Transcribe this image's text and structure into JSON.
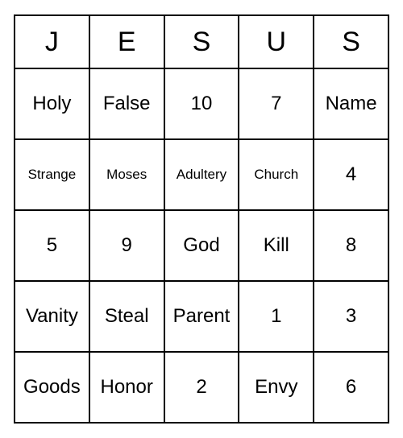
{
  "headers": [
    "J",
    "E",
    "S",
    "U",
    "S"
  ],
  "rows": [
    [
      {
        "text": "Holy",
        "small": false
      },
      {
        "text": "False",
        "small": false
      },
      {
        "text": "10",
        "small": false
      },
      {
        "text": "7",
        "small": false
      },
      {
        "text": "Name",
        "small": false
      }
    ],
    [
      {
        "text": "Strange",
        "small": true
      },
      {
        "text": "Moses",
        "small": true
      },
      {
        "text": "Adultery",
        "small": true
      },
      {
        "text": "Church",
        "small": true
      },
      {
        "text": "4",
        "small": false
      }
    ],
    [
      {
        "text": "5",
        "small": false
      },
      {
        "text": "9",
        "small": false
      },
      {
        "text": "God",
        "small": false
      },
      {
        "text": "Kill",
        "small": false
      },
      {
        "text": "8",
        "small": false
      }
    ],
    [
      {
        "text": "Vanity",
        "small": false
      },
      {
        "text": "Steal",
        "small": false
      },
      {
        "text": "Parent",
        "small": false
      },
      {
        "text": "1",
        "small": false
      },
      {
        "text": "3",
        "small": false
      }
    ],
    [
      {
        "text": "Goods",
        "small": false
      },
      {
        "text": "Honor",
        "small": false
      },
      {
        "text": "2",
        "small": false
      },
      {
        "text": "Envy",
        "small": false
      },
      {
        "text": "6",
        "small": false
      }
    ]
  ]
}
